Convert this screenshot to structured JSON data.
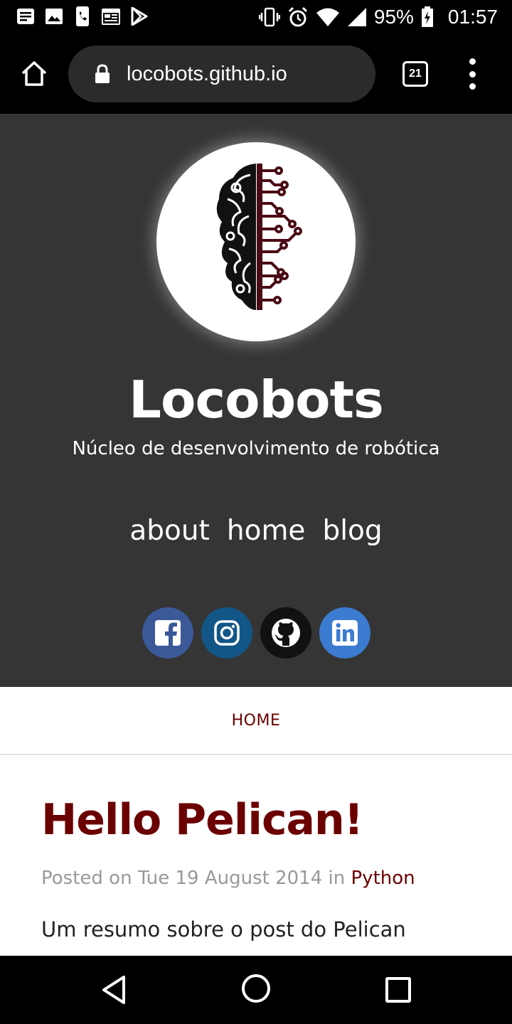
{
  "status_bar": {
    "battery": "95%",
    "time": "01:57",
    "left_icons": [
      "notes-icon",
      "image-icon",
      "phone-icon",
      "calendar-icon",
      "play-store-icon"
    ],
    "right_icons": [
      "vibrate-icon",
      "alarm-icon",
      "wifi-icon",
      "signal-icon",
      "battery-charging-icon"
    ]
  },
  "browser": {
    "url": "locobots.github.io",
    "tab_count": "21"
  },
  "site": {
    "title": "Locobots",
    "subtitle": "Núcleo de desenvolvimento de robótica",
    "nav": [
      "about",
      "home",
      "blog"
    ],
    "social": [
      {
        "name": "facebook",
        "color": "#3b5998"
      },
      {
        "name": "instagram",
        "color": "#125688"
      },
      {
        "name": "github",
        "color": "#111111"
      },
      {
        "name": "linkedin",
        "color": "#3b7bd0"
      }
    ]
  },
  "breadcrumb": "HOME",
  "post": {
    "title": "Hello Pelican!",
    "meta_prefix": "Posted on Tue 19 August 2014 in",
    "category": "Python",
    "summary": "Um resumo sobre o post do Pelican"
  },
  "colors": {
    "header_bg": "#353535",
    "accent": "#6b0000"
  }
}
